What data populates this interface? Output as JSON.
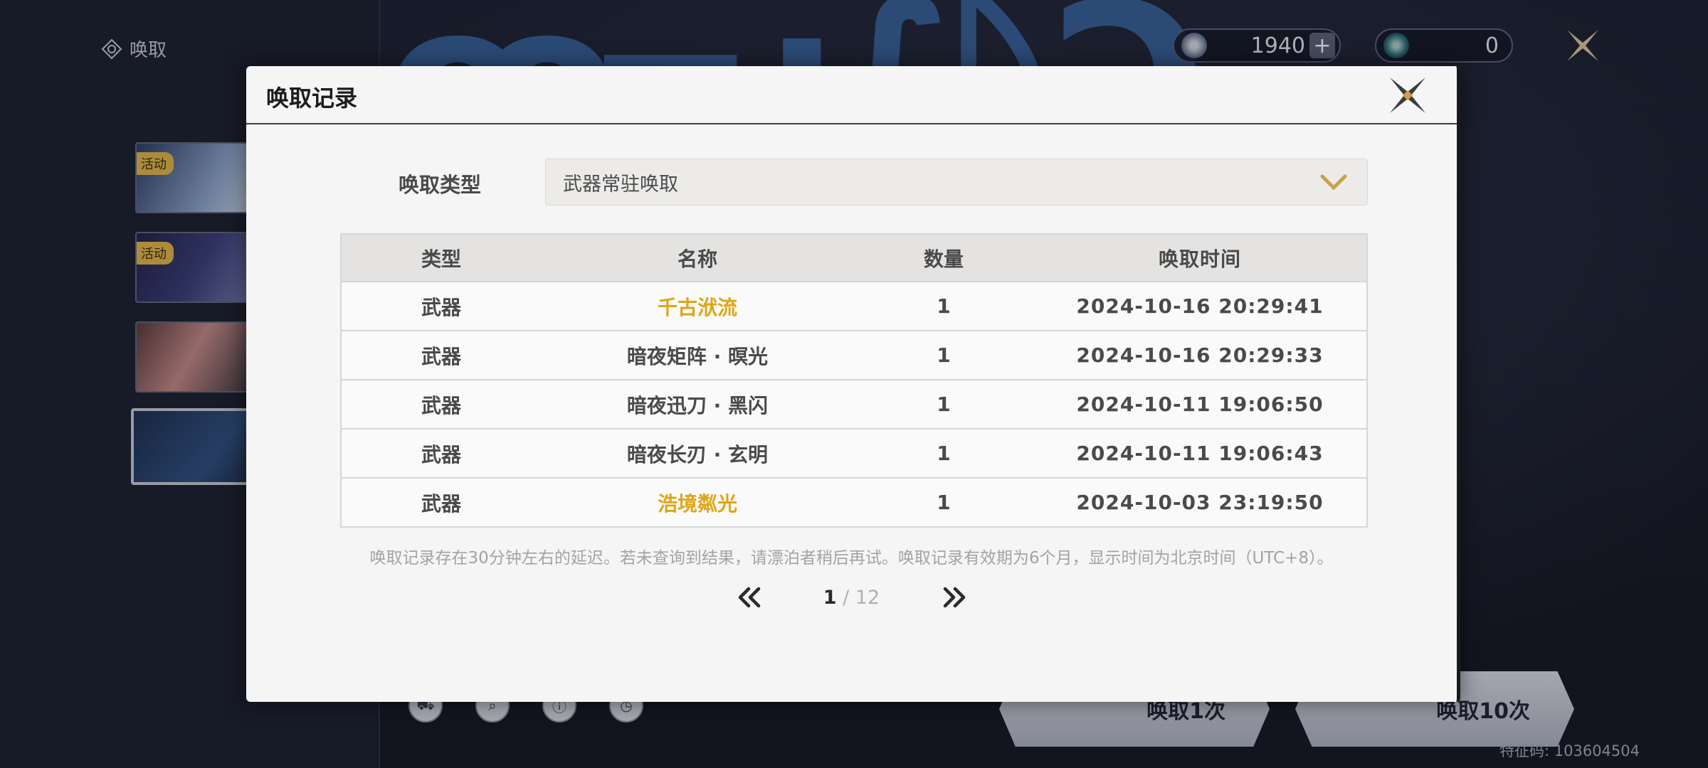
{
  "nav": {
    "title": "唤取",
    "icon": "convene-icon"
  },
  "banners": [
    {
      "tag": "活动"
    },
    {
      "tag": "活动"
    },
    {
      "tag": ""
    },
    {
      "tag": ""
    }
  ],
  "background_logo": "鸣潮 WUTHERING WAVES",
  "currencies": {
    "radiant_tide": {
      "value": "1940",
      "add_label": "+"
    },
    "lustrous_tide": {
      "value": "0"
    }
  },
  "bottom_actions": {
    "pull_1": "唤取1次",
    "pull_10": "唤取10次"
  },
  "feature_code": "特征码: 103604504",
  "modal": {
    "title": "唤取记录",
    "type_label": "唤取类型",
    "type_value": "武器常驻唤取",
    "columns": [
      "类型",
      "名称",
      "数量",
      "唤取时间"
    ],
    "rows": [
      {
        "type": "武器",
        "name": "千古洑流",
        "qty": "1",
        "time": "2024-10-16 20:29:41",
        "highlight": true
      },
      {
        "type": "武器",
        "name": "暗夜矩阵 · 暝光",
        "qty": "1",
        "time": "2024-10-16 20:29:33",
        "highlight": false
      },
      {
        "type": "武器",
        "name": "暗夜迅刀 · 黑闪",
        "qty": "1",
        "time": "2024-10-11 19:06:50",
        "highlight": false
      },
      {
        "type": "武器",
        "name": "暗夜长刃 · 玄明",
        "qty": "1",
        "time": "2024-10-11 19:06:43",
        "highlight": false
      },
      {
        "type": "武器",
        "name": "浩境粼光",
        "qty": "1",
        "time": "2024-10-03 23:19:50",
        "highlight": true
      }
    ],
    "note": "唤取记录存在30分钟左右的延迟。若未查询到结果，请漂泊者稍后再试。唤取记录有效期为6个月，显示时间为北京时间（UTC+8）。",
    "pager": {
      "current": "1",
      "separator": " / ",
      "total": "12"
    }
  },
  "colors": {
    "highlight": "#e0a516",
    "accent_gold": "#c9a24a",
    "modal_bg": "#f5f5f5"
  }
}
